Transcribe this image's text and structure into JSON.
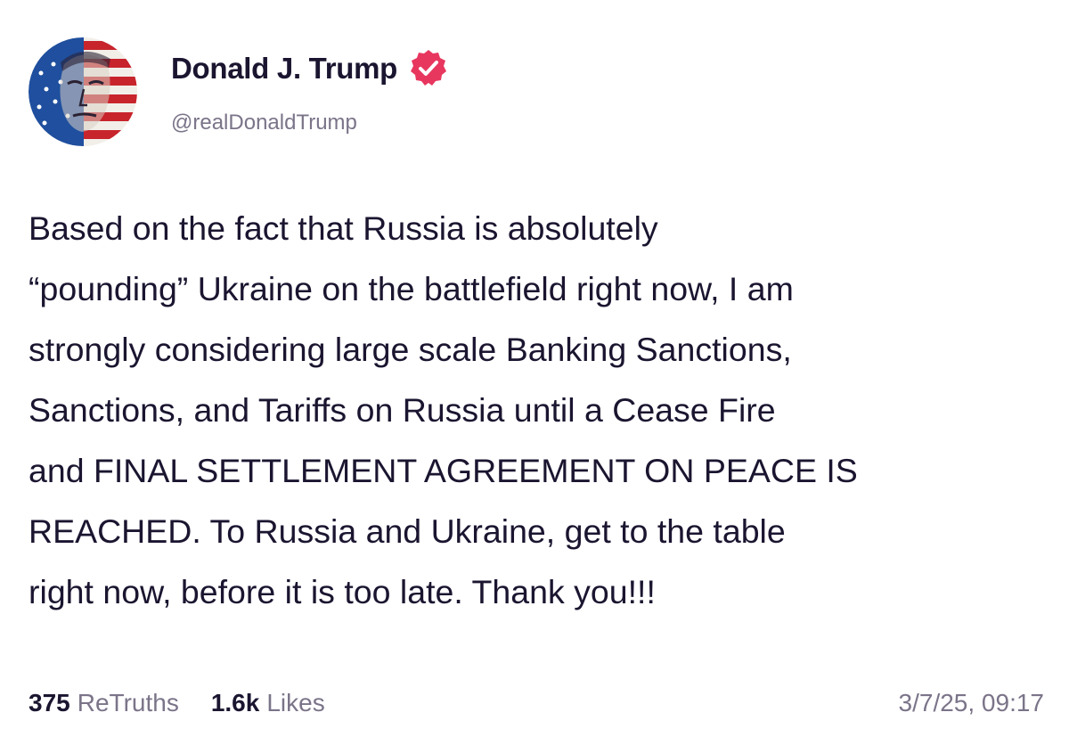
{
  "author": {
    "display_name": "Donald J. Trump",
    "handle": "@realDonaldTrump",
    "verified": true,
    "verified_icon": "verified-badge-icon",
    "verified_color": "#e8375f",
    "avatar_icon": "profile-avatar"
  },
  "post": {
    "text": "Based on the fact that Russia is absolutely\n“pounding” Ukraine on the battlefield right now, I am\nstrongly considering large scale Banking Sanctions,\nSanctions, and Tariffs on Russia until a Cease Fire\nand FINAL SETTLEMENT AGREEMENT ON PEACE IS\nREACHED. To Russia and Ukraine, get to the table\nright now, before it is too late. Thank you!!!"
  },
  "stats": {
    "retruths_count": "375",
    "retruths_label": "ReTruths",
    "likes_count": "1.6k",
    "likes_label": "Likes"
  },
  "timestamp": "3/7/25, 09:17",
  "colors": {
    "text_primary": "#1b1530",
    "text_secondary": "#7b7489",
    "background": "#ffffff",
    "accent": "#e8375f"
  }
}
